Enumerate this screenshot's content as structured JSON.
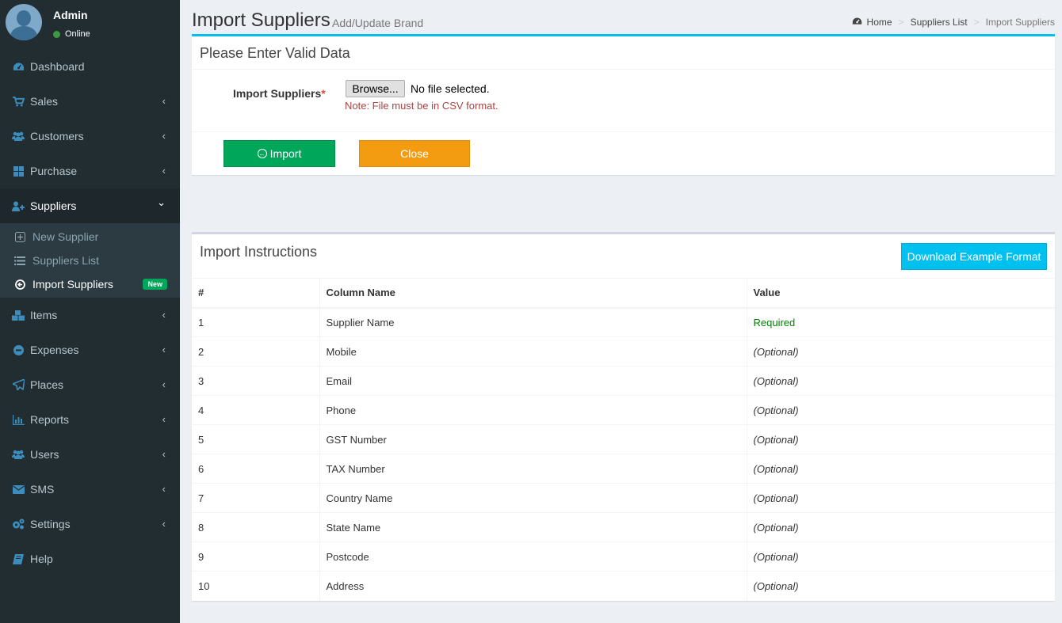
{
  "user": {
    "name": "Admin",
    "status": "Online"
  },
  "menu": [
    {
      "label": "Dashboard",
      "icon": "dashboard-icon",
      "chevron": ""
    },
    {
      "label": "Sales",
      "icon": "cart-icon",
      "chevron": "‹"
    },
    {
      "label": "Customers",
      "icon": "users-icon",
      "chevron": "‹"
    },
    {
      "label": "Purchase",
      "icon": "grid-icon",
      "chevron": "‹"
    },
    {
      "label": "Suppliers",
      "icon": "user-plus-icon",
      "chevron": "⌄"
    }
  ],
  "submenu": [
    {
      "label": "New Supplier",
      "icon": "plus-square-icon"
    },
    {
      "label": "Suppliers List",
      "icon": "list-icon"
    },
    {
      "label": "Import Suppliers",
      "icon": "arrow-circle-left-icon",
      "badge": "New"
    }
  ],
  "menu2": [
    {
      "label": "Items",
      "icon": "cubes-icon"
    },
    {
      "label": "Expenses",
      "icon": "minus-circle-icon"
    },
    {
      "label": "Places",
      "icon": "paper-plane-icon"
    },
    {
      "label": "Reports",
      "icon": "bar-chart-icon"
    },
    {
      "label": "Users",
      "icon": "users-icon"
    },
    {
      "label": "SMS",
      "icon": "envelope-icon"
    },
    {
      "label": "Settings",
      "icon": "cogs-icon"
    },
    {
      "label": "Help",
      "icon": "book-icon"
    }
  ],
  "header": {
    "title": "Import Suppliers",
    "subtitle": "Add/Update Brand",
    "breadcrumb": [
      "Home",
      "Suppliers List",
      "Import Suppliers"
    ]
  },
  "form": {
    "title": "Please Enter Valid Data",
    "label": "Import Suppliers",
    "required_mark": "*",
    "browse_label": "Browse...",
    "file_status": "No file selected.",
    "note": "Note: File must be in CSV format.",
    "import_label": "Import",
    "close_label": "Close"
  },
  "instructions": {
    "title": "Import Instructions",
    "download_label": "Download Example Format",
    "headers": [
      "#",
      "Column Name",
      "Value"
    ],
    "rows": [
      [
        "1",
        "Supplier Name",
        "Required"
      ],
      [
        "2",
        "Mobile",
        "(Optional)"
      ],
      [
        "3",
        "Email",
        "(Optional)"
      ],
      [
        "4",
        "Phone",
        "(Optional)"
      ],
      [
        "5",
        "GST Number",
        "(Optional)"
      ],
      [
        "6",
        "TAX Number",
        "(Optional)"
      ],
      [
        "7",
        "Country Name",
        "(Optional)"
      ],
      [
        "8",
        "State Name",
        "(Optional)"
      ],
      [
        "9",
        "Postcode",
        "(Optional)"
      ],
      [
        "10",
        "Address",
        "(Optional)"
      ]
    ]
  },
  "colors": {
    "sidebar": "#222d32",
    "accent": "#00c0ef",
    "icon": "#3c8dbc",
    "import_btn": "#00a65a",
    "close_btn": "#f39c12",
    "required": "#008000"
  }
}
